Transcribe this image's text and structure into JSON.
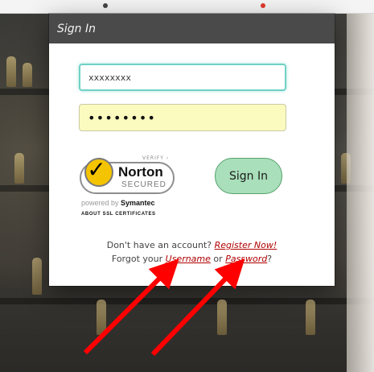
{
  "dialog": {
    "title": "Sign In",
    "username_value": "xxxxxxxx",
    "password_value": "••••••••",
    "signin_label": "Sign In"
  },
  "security_badge": {
    "verify": "VERIFY ›",
    "brand": "Norton",
    "secured": "SECURED",
    "powered_prefix": "powered by ",
    "powered_brand": "Symantec",
    "about": "ABOUT SSL CERTIFICATES"
  },
  "links": {
    "no_account_text": "Don't have an account?",
    "register_label": "Register Now!",
    "forgot_prefix": "Forgot your",
    "username_label": "Username",
    "or_text": "or",
    "password_label": "Password",
    "question_mark": "?"
  },
  "colors": {
    "annotation_arrows": "#ff0000",
    "signin_button_bg": "#a9dfba",
    "password_field_bg": "#fbfbbf",
    "link_color": "#b00000"
  }
}
